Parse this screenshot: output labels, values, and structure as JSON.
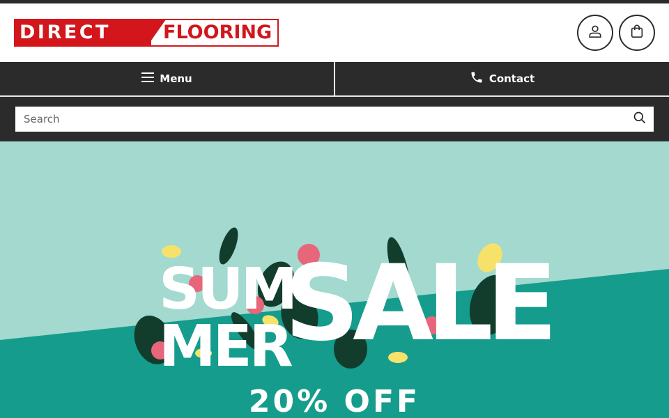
{
  "brand": {
    "word1": "DIRECT",
    "word2": "FLOORING",
    "primary_color": "#d2161c"
  },
  "header": {
    "account_icon": "user-icon",
    "cart_icon": "shopping-bag-icon"
  },
  "nav": {
    "menu_label": "Menu",
    "menu_icon": "hamburger-icon",
    "contact_label": "Contact",
    "contact_icon": "phone-icon"
  },
  "search": {
    "placeholder": "Search",
    "icon": "search-icon"
  },
  "banner": {
    "headline_line1": "SUM",
    "headline_line2": "MER",
    "headline_sale": "SALE",
    "offer": "20% OFF",
    "colors": {
      "light_teal": "#a3d9cf",
      "dark_teal": "#159c8c"
    }
  },
  "colors": {
    "dark_bar": "#2b2b2b"
  }
}
